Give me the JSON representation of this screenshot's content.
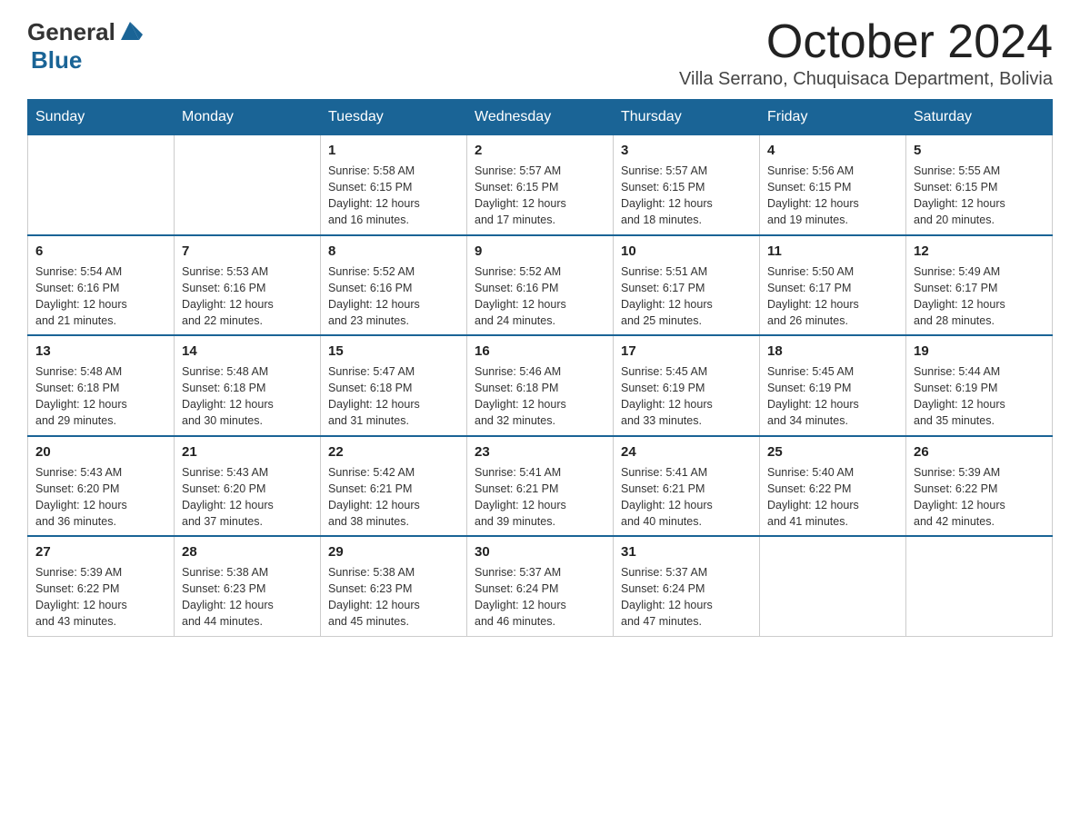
{
  "logo": {
    "general": "General",
    "blue": "Blue"
  },
  "header": {
    "month": "October 2024",
    "location": "Villa Serrano, Chuquisaca Department, Bolivia"
  },
  "weekdays": [
    "Sunday",
    "Monday",
    "Tuesday",
    "Wednesday",
    "Thursday",
    "Friday",
    "Saturday"
  ],
  "weeks": [
    [
      {
        "day": "",
        "info": ""
      },
      {
        "day": "",
        "info": ""
      },
      {
        "day": "1",
        "info": "Sunrise: 5:58 AM\nSunset: 6:15 PM\nDaylight: 12 hours\nand 16 minutes."
      },
      {
        "day": "2",
        "info": "Sunrise: 5:57 AM\nSunset: 6:15 PM\nDaylight: 12 hours\nand 17 minutes."
      },
      {
        "day": "3",
        "info": "Sunrise: 5:57 AM\nSunset: 6:15 PM\nDaylight: 12 hours\nand 18 minutes."
      },
      {
        "day": "4",
        "info": "Sunrise: 5:56 AM\nSunset: 6:15 PM\nDaylight: 12 hours\nand 19 minutes."
      },
      {
        "day": "5",
        "info": "Sunrise: 5:55 AM\nSunset: 6:15 PM\nDaylight: 12 hours\nand 20 minutes."
      }
    ],
    [
      {
        "day": "6",
        "info": "Sunrise: 5:54 AM\nSunset: 6:16 PM\nDaylight: 12 hours\nand 21 minutes."
      },
      {
        "day": "7",
        "info": "Sunrise: 5:53 AM\nSunset: 6:16 PM\nDaylight: 12 hours\nand 22 minutes."
      },
      {
        "day": "8",
        "info": "Sunrise: 5:52 AM\nSunset: 6:16 PM\nDaylight: 12 hours\nand 23 minutes."
      },
      {
        "day": "9",
        "info": "Sunrise: 5:52 AM\nSunset: 6:16 PM\nDaylight: 12 hours\nand 24 minutes."
      },
      {
        "day": "10",
        "info": "Sunrise: 5:51 AM\nSunset: 6:17 PM\nDaylight: 12 hours\nand 25 minutes."
      },
      {
        "day": "11",
        "info": "Sunrise: 5:50 AM\nSunset: 6:17 PM\nDaylight: 12 hours\nand 26 minutes."
      },
      {
        "day": "12",
        "info": "Sunrise: 5:49 AM\nSunset: 6:17 PM\nDaylight: 12 hours\nand 28 minutes."
      }
    ],
    [
      {
        "day": "13",
        "info": "Sunrise: 5:48 AM\nSunset: 6:18 PM\nDaylight: 12 hours\nand 29 minutes."
      },
      {
        "day": "14",
        "info": "Sunrise: 5:48 AM\nSunset: 6:18 PM\nDaylight: 12 hours\nand 30 minutes."
      },
      {
        "day": "15",
        "info": "Sunrise: 5:47 AM\nSunset: 6:18 PM\nDaylight: 12 hours\nand 31 minutes."
      },
      {
        "day": "16",
        "info": "Sunrise: 5:46 AM\nSunset: 6:18 PM\nDaylight: 12 hours\nand 32 minutes."
      },
      {
        "day": "17",
        "info": "Sunrise: 5:45 AM\nSunset: 6:19 PM\nDaylight: 12 hours\nand 33 minutes."
      },
      {
        "day": "18",
        "info": "Sunrise: 5:45 AM\nSunset: 6:19 PM\nDaylight: 12 hours\nand 34 minutes."
      },
      {
        "day": "19",
        "info": "Sunrise: 5:44 AM\nSunset: 6:19 PM\nDaylight: 12 hours\nand 35 minutes."
      }
    ],
    [
      {
        "day": "20",
        "info": "Sunrise: 5:43 AM\nSunset: 6:20 PM\nDaylight: 12 hours\nand 36 minutes."
      },
      {
        "day": "21",
        "info": "Sunrise: 5:43 AM\nSunset: 6:20 PM\nDaylight: 12 hours\nand 37 minutes."
      },
      {
        "day": "22",
        "info": "Sunrise: 5:42 AM\nSunset: 6:21 PM\nDaylight: 12 hours\nand 38 minutes."
      },
      {
        "day": "23",
        "info": "Sunrise: 5:41 AM\nSunset: 6:21 PM\nDaylight: 12 hours\nand 39 minutes."
      },
      {
        "day": "24",
        "info": "Sunrise: 5:41 AM\nSunset: 6:21 PM\nDaylight: 12 hours\nand 40 minutes."
      },
      {
        "day": "25",
        "info": "Sunrise: 5:40 AM\nSunset: 6:22 PM\nDaylight: 12 hours\nand 41 minutes."
      },
      {
        "day": "26",
        "info": "Sunrise: 5:39 AM\nSunset: 6:22 PM\nDaylight: 12 hours\nand 42 minutes."
      }
    ],
    [
      {
        "day": "27",
        "info": "Sunrise: 5:39 AM\nSunset: 6:22 PM\nDaylight: 12 hours\nand 43 minutes."
      },
      {
        "day": "28",
        "info": "Sunrise: 5:38 AM\nSunset: 6:23 PM\nDaylight: 12 hours\nand 44 minutes."
      },
      {
        "day": "29",
        "info": "Sunrise: 5:38 AM\nSunset: 6:23 PM\nDaylight: 12 hours\nand 45 minutes."
      },
      {
        "day": "30",
        "info": "Sunrise: 5:37 AM\nSunset: 6:24 PM\nDaylight: 12 hours\nand 46 minutes."
      },
      {
        "day": "31",
        "info": "Sunrise: 5:37 AM\nSunset: 6:24 PM\nDaylight: 12 hours\nand 47 minutes."
      },
      {
        "day": "",
        "info": ""
      },
      {
        "day": "",
        "info": ""
      }
    ]
  ]
}
